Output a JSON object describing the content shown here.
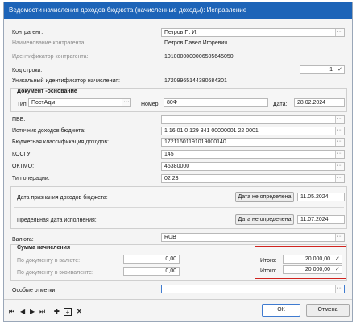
{
  "window": {
    "title": "Ведомости начисления доходов бюджета (начисленные доходы): Исправление"
  },
  "counterparty": {
    "label": "Контрагент:",
    "value": "Петров П. И."
  },
  "counterparty_name": {
    "label": "Наименование контрагента:",
    "value": "Петров Павел Игоревич"
  },
  "counterparty_id": {
    "label": "Идентификатор контрагента:",
    "value": "1010000000006505645050"
  },
  "line_code": {
    "label": "Код строки:",
    "value": "1"
  },
  "accrual_uid": {
    "label": "Уникальный идентификатор начисления:",
    "value": "17209965144380684301"
  },
  "base_doc": {
    "section": "Документ -основание",
    "type_label": "Тип:",
    "type_value": "ПостАдм",
    "number_label": "Номер:",
    "number_value": "80Ф",
    "date_label": "Дата:",
    "date_value": "28.02.2024"
  },
  "pve": {
    "label": "ПВЕ:",
    "value": ""
  },
  "income_source": {
    "label": "Источник доходов бюджета:",
    "value": "1 16 01 0 129 341 00000001 22 0001"
  },
  "budget_class": {
    "label": "Бюджетная классификация доходов:",
    "value": "17211601191019000140"
  },
  "kosgu": {
    "label": "КОСГУ:",
    "value": "145"
  },
  "oktmo": {
    "label": "ОКТМО:",
    "value": "45380000"
  },
  "operation_type": {
    "label": "Тип операции:",
    "value": "02 23"
  },
  "recognition_date": {
    "label": "Дата признания доходов бюджета:",
    "button": "Дата не определена",
    "value": "11.05.2024"
  },
  "due_date": {
    "label": "Предельная дата исполнения:",
    "button": "Дата не определена",
    "value": "11.07.2024"
  },
  "currency": {
    "label": "Валюта:",
    "value": "RUB"
  },
  "accrual_sum": {
    "section": "Сумма начисления",
    "by_doc_currency_label": "По документу в валюте:",
    "by_doc_currency_value": "0,00",
    "by_doc_equiv_label": "По документу в эквиваленте:",
    "by_doc_equiv_value": "0,00",
    "total_label": "Итого:",
    "total1": "20 000,00",
    "total2": "20 000,00"
  },
  "special_marks": {
    "label": "Особые отметки:",
    "value": ""
  },
  "icons": [
    "first-icon",
    "prev-icon",
    "next-icon",
    "last-icon",
    "add-icon",
    "add-box-icon",
    "delete-icon"
  ],
  "footer": {
    "ok": "ОК",
    "cancel": "Отмена"
  },
  "colors": {
    "title_bar": "#1d64b8",
    "highlight": "#d0241f"
  }
}
